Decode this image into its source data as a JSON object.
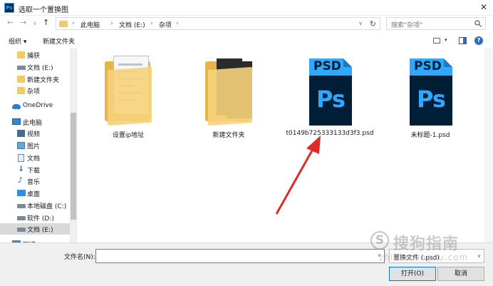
{
  "window": {
    "title": "选取一个置换图",
    "app_icon_text": "Ps",
    "close_glyph": "✕"
  },
  "nav": {
    "back_glyph": "←",
    "forward_glyph": "→",
    "dropdown_glyph": "∨",
    "up_glyph": "↑"
  },
  "address": {
    "separator_glyph": "›",
    "breadcrumbs": [
      "此电脑",
      "文档 (E:)",
      "杂项"
    ],
    "dropdown_glyph": "∨",
    "refresh_glyph": "↻"
  },
  "search": {
    "placeholder": "搜索\"杂项\""
  },
  "toolbar": {
    "organize_label": "组织 ▾",
    "new_folder_label": "新建文件夹",
    "view_dropdown_glyph": "▾",
    "help_glyph": "?"
  },
  "sidebar": {
    "items": [
      {
        "label": "捕获",
        "icon": "folder-icon"
      },
      {
        "label": "文档 (E:)",
        "icon": "drive-icon"
      },
      {
        "label": "新建文件夹",
        "icon": "folder-icon"
      },
      {
        "label": "杂项",
        "icon": "folder-icon"
      },
      {
        "label": "OneDrive",
        "icon": "onedrive-icon"
      },
      {
        "label": "此电脑",
        "icon": "pc-icon"
      },
      {
        "label": "视频",
        "icon": "video-icon"
      },
      {
        "label": "图片",
        "icon": "pictures-icon"
      },
      {
        "label": "文档",
        "icon": "documents-icon"
      },
      {
        "label": "下载",
        "icon": "download-icon"
      },
      {
        "label": "音乐",
        "icon": "music-icon"
      },
      {
        "label": "桌面",
        "icon": "desktop-icon"
      },
      {
        "label": "本地磁盘 (C:)",
        "icon": "drive-icon"
      },
      {
        "label": "软件 (D:)",
        "icon": "drive-icon"
      },
      {
        "label": "文档 (E:)",
        "icon": "drive-icon",
        "selected": true
      },
      {
        "label": "网络",
        "icon": "network-icon"
      }
    ],
    "download_glyph": "↓",
    "music_glyph": "♪"
  },
  "files": [
    {
      "name": "设置ip地址",
      "type": "folder"
    },
    {
      "name": "新建文件夹",
      "type": "folder"
    },
    {
      "name": "t0149b725333133d3f3.psd",
      "type": "psd"
    },
    {
      "name": "未标题-1.psd",
      "type": "psd"
    }
  ],
  "psd_icon": {
    "top_text": "PSD",
    "body_text": "Ps",
    "accent": "#31a8ff",
    "dark": "#001e36"
  },
  "footer": {
    "filename_label": "文件名(N):",
    "filename_value": "",
    "filename_dropdown_glyph": "∨",
    "filetype_value": "置换文件 (.psd)",
    "filetype_dropdown_glyph": "∨",
    "open_label": "打开(O)",
    "cancel_label": "取消"
  },
  "watermark": {
    "logo_letter": "S",
    "text": "搜狗指南",
    "url": "zhinan.sogou.com"
  },
  "colors": {
    "annotation_arrow": "#e02a2a",
    "folder": "#f6d27a",
    "selection": "#d9d9d9"
  }
}
